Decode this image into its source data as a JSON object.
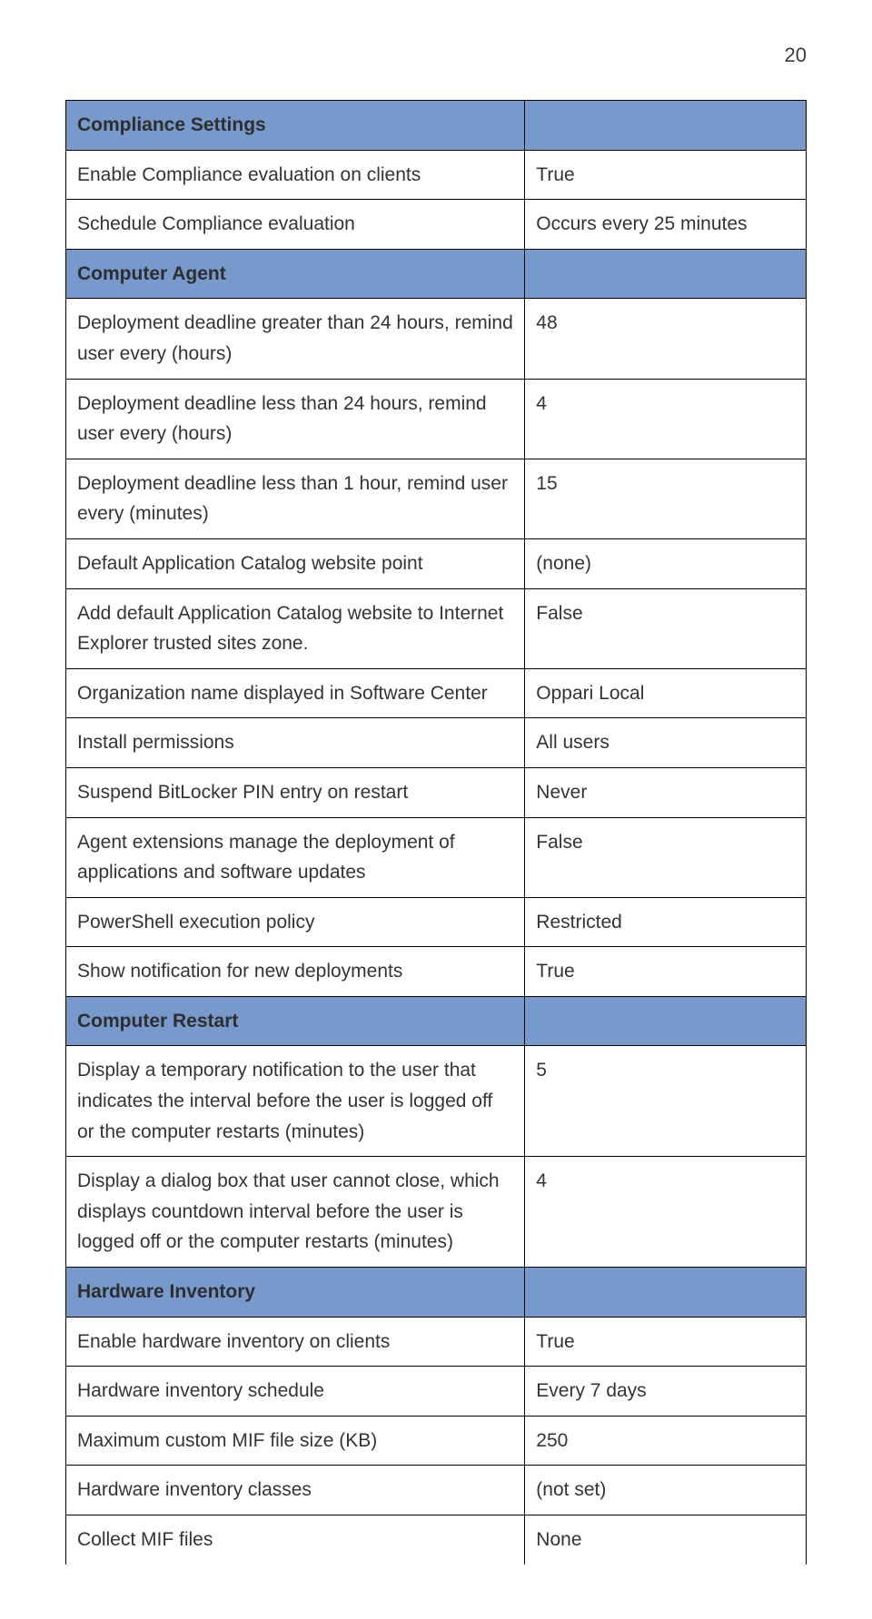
{
  "page_number": "20",
  "rows": [
    {
      "type": "section",
      "label": "Compliance Settings",
      "value": ""
    },
    {
      "type": "data",
      "label": "Enable Compliance evaluation on clients",
      "value": "True"
    },
    {
      "type": "data",
      "label": "Schedule Compliance evaluation",
      "value": "Occurs every 25 minutes"
    },
    {
      "type": "section",
      "label": "Computer Agent",
      "value": ""
    },
    {
      "type": "data",
      "label": "Deployment deadline greater than 24 hours, remind user every (hours)",
      "value": "48"
    },
    {
      "type": "data",
      "label": "Deployment deadline less than 24 hours, remind user every (hours)",
      "value": "4"
    },
    {
      "type": "data",
      "label": "Deployment deadline less than 1 hour, remind user every (minutes)",
      "value": "15"
    },
    {
      "type": "data",
      "label": "Default Application Catalog website point",
      "value": "(none)"
    },
    {
      "type": "data",
      "label": "Add default Application Catalog website to Internet Explorer trusted sites zone.",
      "value": "False"
    },
    {
      "type": "data",
      "label": "Organization name displayed in Software Center",
      "value": "Oppari Local"
    },
    {
      "type": "data",
      "label": "Install permissions",
      "value": "All users"
    },
    {
      "type": "data",
      "label": "Suspend BitLocker PIN entry on restart",
      "value": "Never"
    },
    {
      "type": "data",
      "label": "Agent extensions manage the deployment of applications and software updates",
      "value": "False"
    },
    {
      "type": "data",
      "label": "PowerShell execution policy",
      "value": "Restricted"
    },
    {
      "type": "data",
      "label": "Show notification for new deployments",
      "value": "True"
    },
    {
      "type": "section",
      "label": "Computer Restart",
      "value": ""
    },
    {
      "type": "data",
      "label": "Display a temporary notification to the user that indicates the interval before the user is logged off or the computer restarts (minutes)",
      "value": "5"
    },
    {
      "type": "data",
      "label": "Display a dialog box that user cannot close, which displays countdown interval before the user is logged off or the computer restarts (minutes)",
      "value": "4"
    },
    {
      "type": "section",
      "label": "Hardware Inventory",
      "value": ""
    },
    {
      "type": "data",
      "label": "Enable hardware inventory on clients",
      "value": "True"
    },
    {
      "type": "data",
      "label": "Hardware inventory schedule",
      "value": "Every 7 days"
    },
    {
      "type": "data",
      "label": "Maximum custom MIF file size (KB)",
      "value": "250"
    },
    {
      "type": "data",
      "label": "Hardware inventory classes",
      "value": "(not set)"
    },
    {
      "type": "data",
      "label": "Collect MIF files",
      "value": "None"
    }
  ]
}
